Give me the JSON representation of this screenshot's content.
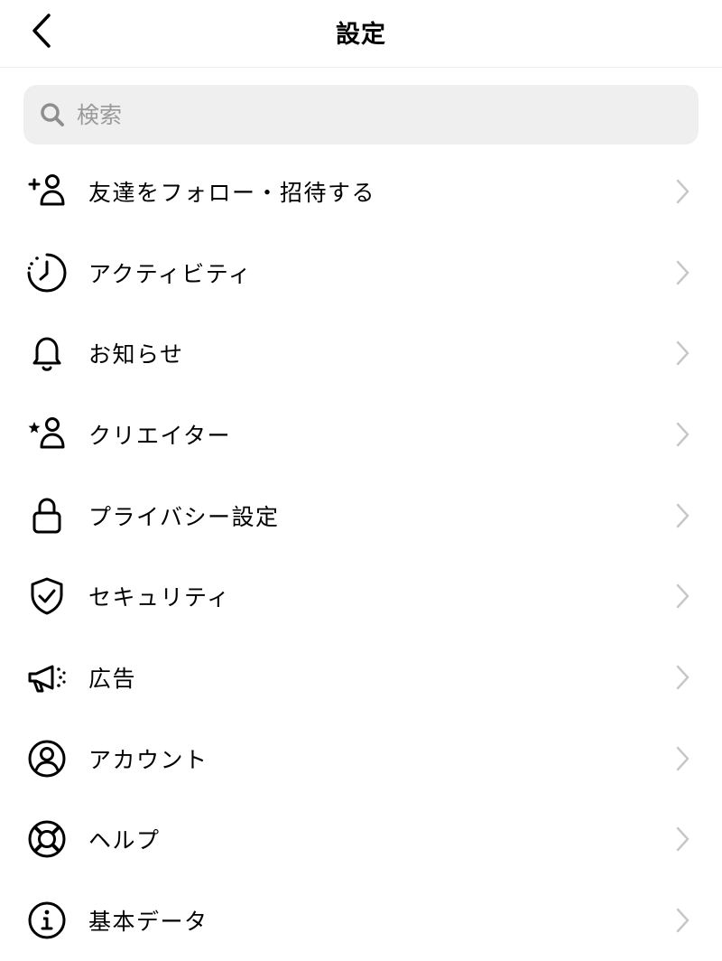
{
  "header": {
    "title": "設定",
    "back_icon": "chevron-left-icon"
  },
  "search": {
    "placeholder": "検索",
    "value": "",
    "icon": "search-icon"
  },
  "menu": [
    {
      "label": "友達をフォロー・招待する",
      "icon": "add-person-icon"
    },
    {
      "label": "アクティビティ",
      "icon": "activity-clock-icon"
    },
    {
      "label": "お知らせ",
      "icon": "bell-icon"
    },
    {
      "label": "クリエイター",
      "icon": "star-person-icon"
    },
    {
      "label": "プライバシー設定",
      "icon": "lock-icon"
    },
    {
      "label": "セキュリティ",
      "icon": "shield-check-icon"
    },
    {
      "label": "広告",
      "icon": "megaphone-icon"
    },
    {
      "label": "アカウント",
      "icon": "account-circle-icon"
    },
    {
      "label": "ヘルプ",
      "icon": "lifebuoy-icon"
    },
    {
      "label": "基本データ",
      "icon": "info-icon"
    }
  ],
  "colors": {
    "search_bg": "#efefef",
    "chevron": "#c7c7c7",
    "placeholder": "#9a9a9a"
  }
}
